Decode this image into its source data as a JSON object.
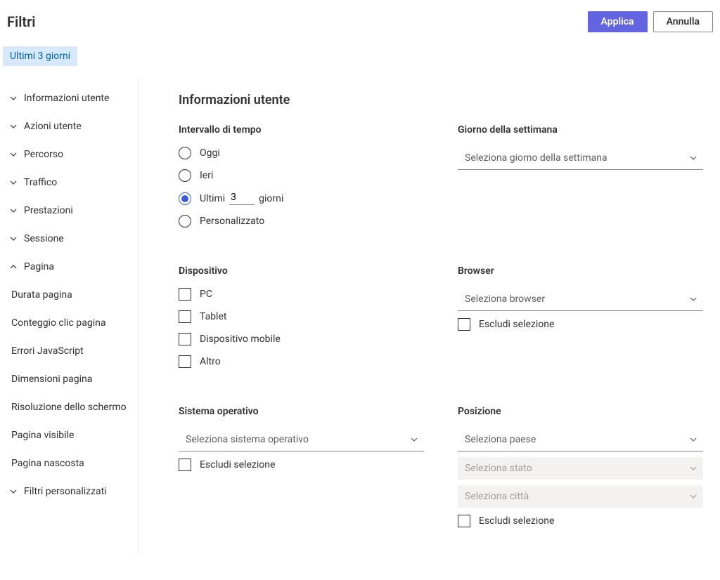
{
  "header": {
    "title": "Filtri",
    "apply": "Applica",
    "cancel": "Annulla"
  },
  "chips": [
    "Ultimi 3 giorni"
  ],
  "sidebar": {
    "items": [
      {
        "label": "Informazioni utente",
        "expanded": false
      },
      {
        "label": "Azioni utente",
        "expanded": false
      },
      {
        "label": "Percorso",
        "expanded": false
      },
      {
        "label": "Traffico",
        "expanded": false
      },
      {
        "label": "Prestazioni",
        "expanded": false
      },
      {
        "label": "Sessione",
        "expanded": false
      },
      {
        "label": "Pagina",
        "expanded": true,
        "children": [
          "Durata pagina",
          "Conteggio clic pagina",
          "Errori JavaScript",
          "Dimensioni pagina",
          "Risoluzione dello schermo",
          "Pagina visibile",
          "Pagina nascosta"
        ]
      },
      {
        "label": "Filtri personalizzati",
        "expanded": false
      }
    ]
  },
  "content": {
    "section_title": "Informazioni utente",
    "timeframe": {
      "label": "Intervallo di tempo",
      "options": {
        "today": "Oggi",
        "yesterday": "Ieri",
        "lastn_prefix": "Ultimi",
        "lastn_value": "3",
        "lastn_suffix": "giorni",
        "custom": "Personalizzato"
      },
      "selected": "lastn"
    },
    "weekday": {
      "label": "Giorno della settimana",
      "placeholder": "Seleziona giorno della settimana"
    },
    "device": {
      "label": "Dispositivo",
      "options": [
        "PC",
        "Tablet",
        "Dispositivo mobile",
        "Altro"
      ]
    },
    "browser": {
      "label": "Browser",
      "placeholder": "Seleziona browser",
      "exclude": "Escludi selezione"
    },
    "os": {
      "label": "Sistema operativo",
      "placeholder": "Seleziona sistema operativo",
      "exclude": "Escludi selezione"
    },
    "location": {
      "label": "Posizione",
      "country_placeholder": "Seleziona paese",
      "state_placeholder": "Seleziona stato",
      "city_placeholder": "Seleziona città",
      "exclude": "Escludi selezione"
    }
  }
}
